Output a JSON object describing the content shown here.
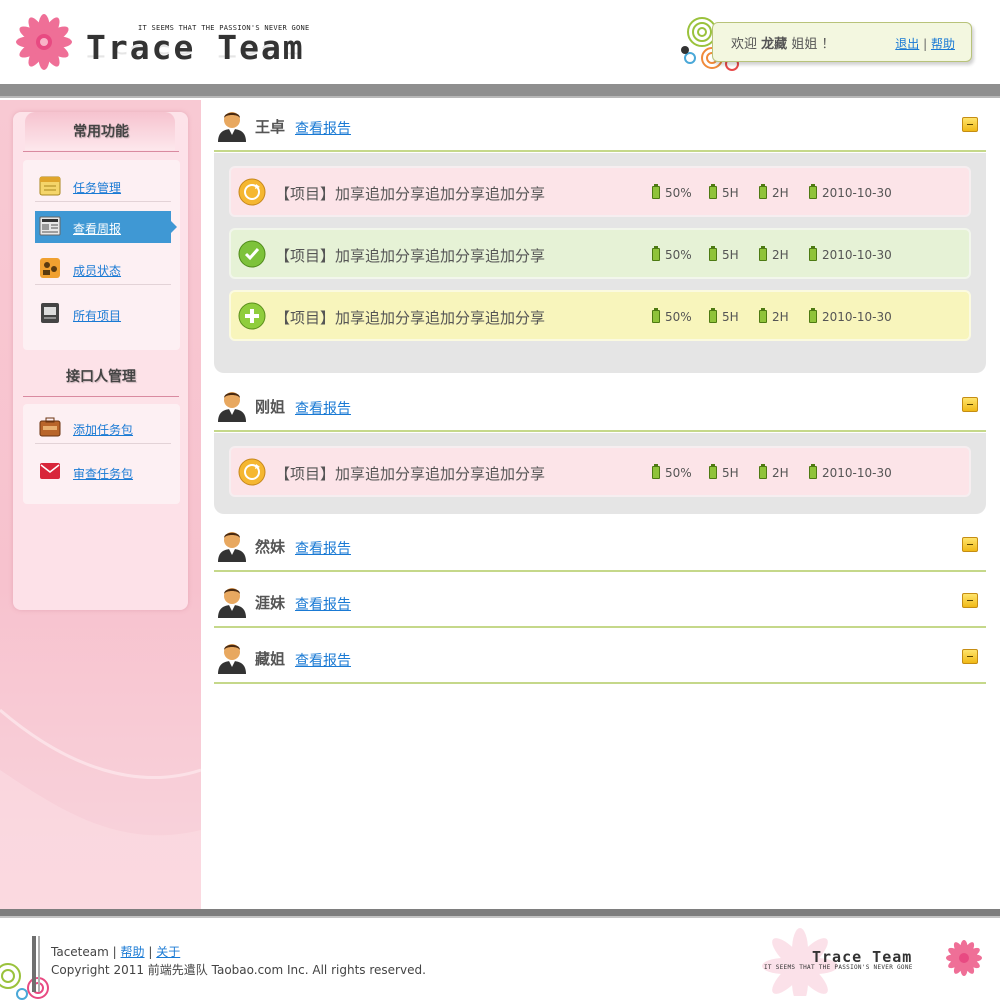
{
  "header": {
    "tagline": "IT SEEMS THAT THE PASSION'S NEVER GONE",
    "brand": "Trace Team",
    "welcome_prefix": "欢迎",
    "username": "龙藏",
    "welcome_suffix": "姐姐 ！",
    "logout": "退出",
    "separator": "|",
    "help": "帮助"
  },
  "sidebar": {
    "section1_title": "常用功能",
    "section1_items": [
      {
        "label": "任务管理",
        "icon": "calendar-icon",
        "active": false
      },
      {
        "label": "查看周报",
        "icon": "newspaper-icon",
        "active": true
      },
      {
        "label": "成员状态",
        "icon": "people-icon",
        "active": false
      },
      {
        "label": "所有项目",
        "icon": "document-icon",
        "active": false
      }
    ],
    "section2_title": "接口人管理",
    "section2_items": [
      {
        "label": "添加任务包",
        "icon": "briefcase-icon"
      },
      {
        "label": "审查任务包",
        "icon": "mail-icon"
      }
    ]
  },
  "main": {
    "report_link": "查看报告",
    "members": [
      {
        "name": "王卓",
        "tasks": [
          {
            "title": "【项目】加享追加分享追加分享追加分享",
            "status": "in-progress",
            "color": "pink",
            "percent": "50%",
            "est": "5H",
            "spent": "2H",
            "date": "2010-10-30"
          },
          {
            "title": "【项目】加享追加分享追加分享追加分享",
            "status": "done",
            "color": "green",
            "percent": "50%",
            "est": "5H",
            "spent": "2H",
            "date": "2010-10-30"
          },
          {
            "title": "【项目】加享追加分享追加分享追加分享",
            "status": "new",
            "color": "yellow",
            "percent": "50%",
            "est": "5H",
            "spent": "2H",
            "date": "2010-10-30"
          }
        ]
      },
      {
        "name": "刚姐",
        "tasks": [
          {
            "title": "【项目】加享追加分享追加分享追加分享",
            "status": "in-progress",
            "color": "pink",
            "percent": "50%",
            "est": "5H",
            "spent": "2H",
            "date": "2010-10-30"
          }
        ]
      },
      {
        "name": "然妹",
        "tasks": []
      },
      {
        "name": "涯妹",
        "tasks": []
      },
      {
        "name": "藏姐",
        "tasks": []
      }
    ]
  },
  "footer": {
    "site": "Taceteam",
    "sep": "|",
    "help": "帮助",
    "about": "关于",
    "copyright": "Copyright 2011 前端先遣队 Taobao.com Inc. All rights reserved.",
    "brand": "Trace Team",
    "tagline": "IT SEEMS THAT THE PASSION'S NEVER GONE"
  },
  "colors": {
    "accent_pink": "#e84a82",
    "active_blue": "#3f98d4",
    "link_blue": "#1a7ad4",
    "divider_green": "#c5d88a",
    "task_pink": "#fce4e8",
    "task_green": "#e6f2d6",
    "task_yellow": "#f8f5bc"
  }
}
